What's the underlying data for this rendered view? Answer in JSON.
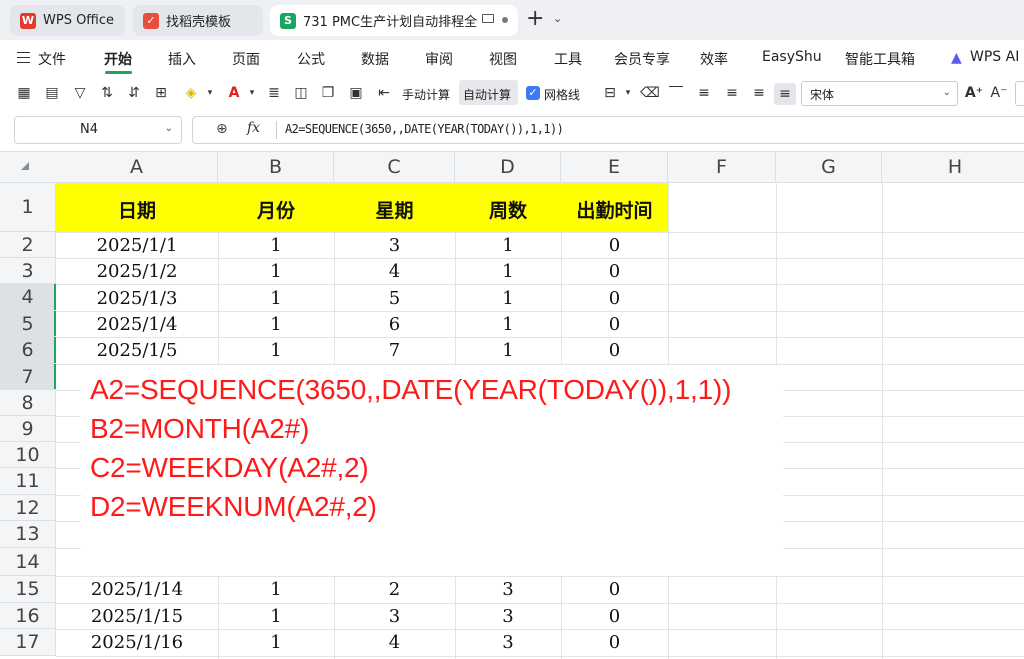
{
  "tabs": [
    {
      "label": "WPS Office",
      "icon": "wps-logo-icon"
    },
    {
      "label": "找稻壳模板",
      "icon": "docer-icon"
    },
    {
      "label": "731 PMC生产计划自动排程全",
      "icon": "spreadsheet-s-icon",
      "badge": "S"
    }
  ],
  "menu": {
    "file": "文件",
    "items": [
      "开始",
      "插入",
      "页面",
      "公式",
      "数据",
      "审阅",
      "视图",
      "工具",
      "会员专享",
      "效率",
      "EasyShu",
      "智能工具箱"
    ],
    "active": "开始",
    "wps_ai": "WPS AI"
  },
  "toolbar": {
    "manual_calc": "手动计算",
    "auto_calc": "自动计算",
    "gridlines": "网格线",
    "font": "宋体"
  },
  "formula_bar": {
    "name_box": "N4",
    "fx": "fx",
    "formula": "A2=SEQUENCE(3650,,DATE(YEAR(TODAY()),1,1))"
  },
  "columns": [
    "A",
    "B",
    "C",
    "D",
    "E",
    "F",
    "G",
    "H"
  ],
  "rows": [
    "1",
    "2",
    "3",
    "4",
    "5",
    "6",
    "7",
    "8",
    "9",
    "10",
    "11",
    "12",
    "13",
    "14",
    "15",
    "16",
    "17"
  ],
  "headers": [
    "日期",
    "月份",
    "星期",
    "周数",
    "出勤时间"
  ],
  "data_rows_top": [
    [
      "2025/1/1",
      "1",
      "3",
      "1",
      "0"
    ],
    [
      "2025/1/2",
      "1",
      "4",
      "1",
      "0"
    ],
    [
      "2025/1/3",
      "1",
      "5",
      "1",
      "0"
    ],
    [
      "2025/1/4",
      "1",
      "6",
      "1",
      "0"
    ],
    [
      "2025/1/5",
      "1",
      "7",
      "1",
      "0"
    ]
  ],
  "data_rows_bottom": [
    [
      "2025/1/14",
      "1",
      "2",
      "3",
      "0"
    ],
    [
      "2025/1/15",
      "1",
      "3",
      "3",
      "0"
    ],
    [
      "2025/1/16",
      "1",
      "4",
      "3",
      "0"
    ]
  ],
  "overlay_lines": [
    "A2=SEQUENCE(3650,,DATE(YEAR(TODAY()),1,1))",
    "B2=MONTH(A2#)",
    "C2=WEEKDAY(A2#,2)",
    "D2=WEEKNUM(A2#,2)"
  ],
  "colors": {
    "accent": "#1aa660",
    "header_fill": "#ffff00",
    "overlay_text": "#ff1a1a"
  }
}
